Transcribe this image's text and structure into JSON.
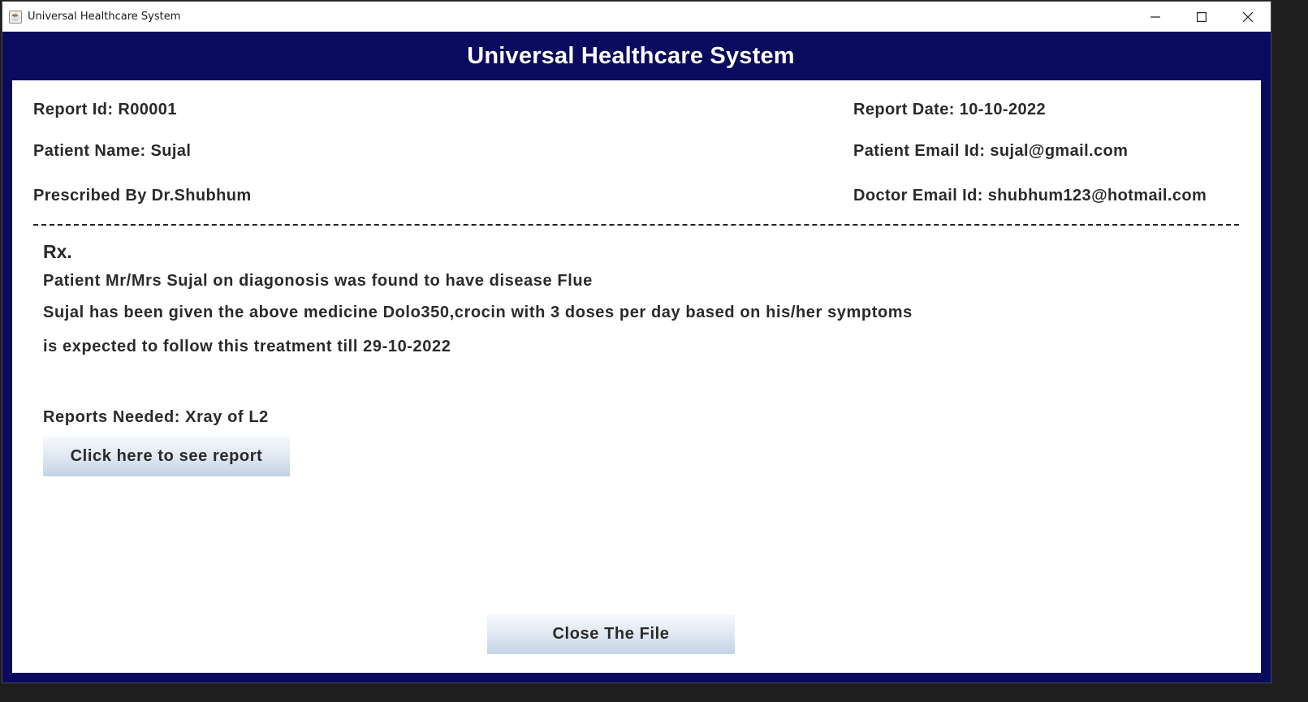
{
  "window": {
    "title": "Universal Healthcare System",
    "icon": "java-cup-icon",
    "controls": [
      "minimize-icon",
      "maximize-icon",
      "close-icon"
    ]
  },
  "header": {
    "title": "Universal Healthcare System"
  },
  "report": {
    "report_id": "Report Id: R00001",
    "report_date": "Report Date: 10-10-2022",
    "patient_name": "Patient Name: Sujal",
    "patient_email": "Patient Email Id: sujal@gmail.com",
    "prescribed_by": "Prescribed By Dr.Shubhum",
    "doctor_email": "Doctor Email Id: shubhum123@hotmail.com"
  },
  "prescription": {
    "rx_label": "Rx.",
    "line1": "Patient Mr/Mrs Sujal on diagonosis was found to have disease Flue",
    "line2": "Sujal has been given the above medicine Dolo350,crocin with 3 doses per day based on his/her symptoms",
    "line3": "is expected to follow this treatment till 29-10-2022",
    "reports_needed": "Reports Needed: Xray of L2"
  },
  "buttons": {
    "see_report": "Click here to see report",
    "close_file": "Close The File"
  },
  "colors": {
    "header_bg": "#0a0a5f",
    "panel_bg": "#ffffff",
    "text": "#2a2a2a"
  }
}
